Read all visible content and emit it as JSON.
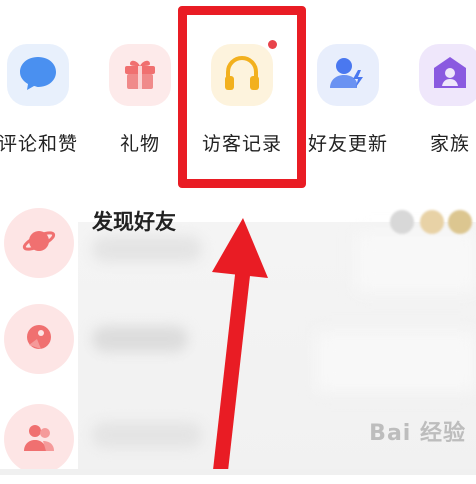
{
  "shortcuts": [
    {
      "label": "评论和赞",
      "icon": "chat-bubble-icon",
      "color": "#4a90f0"
    },
    {
      "label": "礼物",
      "icon": "gift-icon",
      "color": "#f07070"
    },
    {
      "label": "访客记录",
      "icon": "headphones-icon",
      "color": "#f2b01e",
      "has_badge": true
    },
    {
      "label": "好友更新",
      "icon": "add-friend-icon",
      "color": "#4a78f0"
    },
    {
      "label": "家族",
      "icon": "family-icon",
      "color": "#8a5ae0"
    }
  ],
  "list": {
    "first_title": "发现好友",
    "icons": [
      "planet-icon",
      "bird-icon",
      "group-icon"
    ],
    "icon_color": "#f07070"
  },
  "annotation": {
    "color": "#e91c24"
  },
  "watermark": "Bai 经验"
}
